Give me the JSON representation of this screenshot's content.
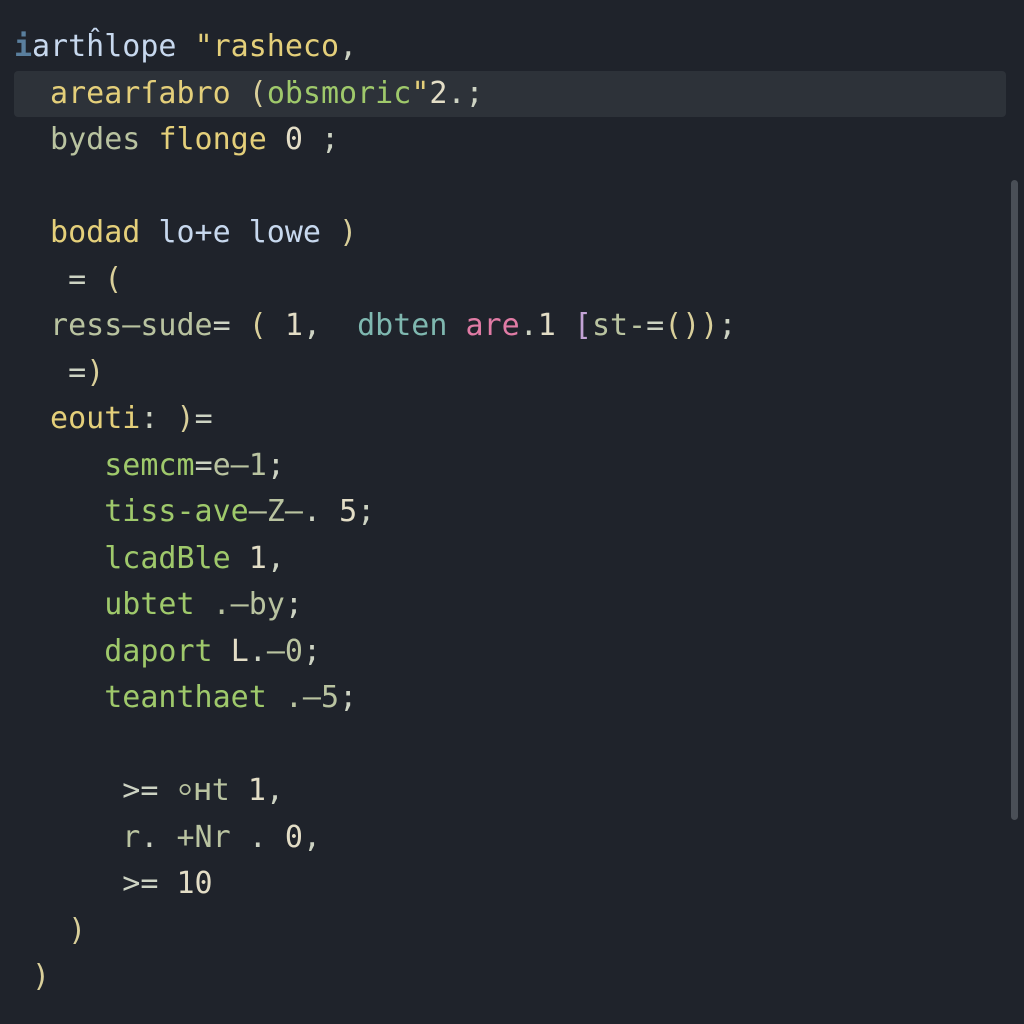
{
  "editor": {
    "gutter_mark": "i",
    "lines": [
      {
        "hl": false,
        "tokens": [
          {
            "t": "artĥlope ",
            "c": "kw"
          },
          {
            "t": "\"",
            "c": "str"
          },
          {
            "t": "rasheco",
            "c": "str"
          },
          {
            "t": ",",
            "c": "punc"
          }
        ]
      },
      {
        "hl": true,
        "tokens": [
          {
            "t": " arearſabro ",
            "c": "fn"
          },
          {
            "t": "(",
            "c": "par"
          },
          {
            "t": "oḃsmoric",
            "c": "id2"
          },
          {
            "t": "\"",
            "c": "str"
          },
          {
            "t": "2",
            "c": "num"
          },
          {
            "t": ".",
            "c": "punc"
          },
          {
            "t": ";",
            "c": "punc"
          }
        ]
      },
      {
        "hl": false,
        "tokens": [
          {
            "t": " bydes ",
            "c": "pale"
          },
          {
            "t": "flonge ",
            "c": "fn"
          },
          {
            "t": "0",
            "c": "num"
          },
          {
            "t": " ;",
            "c": "punc"
          }
        ]
      },
      {
        "hl": false,
        "tokens": [
          {
            "t": "",
            "c": "punc"
          }
        ]
      },
      {
        "hl": false,
        "tokens": [
          {
            "t": " bodad ",
            "c": "fn"
          },
          {
            "t": "lo+e ",
            "c": "kw"
          },
          {
            "t": "lowe ",
            "c": "kw"
          },
          {
            "t": ")",
            "c": "par"
          }
        ]
      },
      {
        "hl": false,
        "tokens": [
          {
            "t": "  = ",
            "c": "op"
          },
          {
            "t": "(",
            "c": "par"
          }
        ]
      },
      {
        "hl": false,
        "tokens": [
          {
            "t": " ress–sude",
            "c": "pale"
          },
          {
            "t": "= ",
            "c": "op"
          },
          {
            "t": "( ",
            "c": "par"
          },
          {
            "t": "1",
            "c": "num"
          },
          {
            "t": ", ",
            "c": "punc"
          },
          {
            "t": " dbten ",
            "c": "teal"
          },
          {
            "t": "are",
            "c": "attr"
          },
          {
            "t": ".",
            "c": "punc"
          },
          {
            "t": "1 ",
            "c": "num"
          },
          {
            "t": "[",
            "c": "br"
          },
          {
            "t": "st-",
            "c": "pale"
          },
          {
            "t": "=",
            "c": "op"
          },
          {
            "t": "(",
            "c": "par"
          },
          {
            "t": ")",
            "c": "par"
          },
          {
            "t": ")",
            "c": "par"
          },
          {
            "t": ";",
            "c": "punc"
          }
        ]
      },
      {
        "hl": false,
        "tokens": [
          {
            "t": "  =",
            "c": "op"
          },
          {
            "t": ")",
            "c": "par"
          }
        ]
      },
      {
        "hl": false,
        "tokens": [
          {
            "t": " eouti",
            "c": "fn"
          },
          {
            "t": ": ",
            "c": "punc"
          },
          {
            "t": ")",
            "c": "par"
          },
          {
            "t": "=",
            "c": "op"
          }
        ]
      },
      {
        "hl": false,
        "tokens": [
          {
            "t": "    semcm",
            "c": "id"
          },
          {
            "t": "=",
            "c": "op"
          },
          {
            "t": "e–1",
            "c": "pale"
          },
          {
            "t": ";",
            "c": "punc"
          }
        ]
      },
      {
        "hl": false,
        "tokens": [
          {
            "t": "    tiss-ave",
            "c": "id"
          },
          {
            "t": "–Z–",
            "c": "pale"
          },
          {
            "t": ". ",
            "c": "punc"
          },
          {
            "t": "5",
            "c": "num"
          },
          {
            "t": ";",
            "c": "punc"
          }
        ]
      },
      {
        "hl": false,
        "tokens": [
          {
            "t": "    lcadBle ",
            "c": "id"
          },
          {
            "t": "1",
            "c": "num"
          },
          {
            "t": ",",
            "c": "punc"
          }
        ]
      },
      {
        "hl": false,
        "tokens": [
          {
            "t": "    ubtet ",
            "c": "id"
          },
          {
            "t": ".–by",
            "c": "pale"
          },
          {
            "t": ";",
            "c": "punc"
          }
        ]
      },
      {
        "hl": false,
        "tokens": [
          {
            "t": "    daport ",
            "c": "id"
          },
          {
            "t": "L",
            "c": "num"
          },
          {
            "t": ".",
            "c": "punc"
          },
          {
            "t": "–0",
            "c": "pale"
          },
          {
            "t": ";",
            "c": "punc"
          }
        ]
      },
      {
        "hl": false,
        "tokens": [
          {
            "t": "    teanthaet ",
            "c": "id"
          },
          {
            "t": ".–5",
            "c": "pale"
          },
          {
            "t": ";",
            "c": "punc"
          }
        ]
      },
      {
        "hl": false,
        "tokens": [
          {
            "t": "",
            "c": "punc"
          }
        ]
      },
      {
        "hl": false,
        "tokens": [
          {
            "t": "     >= ",
            "c": "op"
          },
          {
            "t": "⸰ʜt ",
            "c": "pale"
          },
          {
            "t": "1",
            "c": "num"
          },
          {
            "t": ",",
            "c": "punc"
          }
        ]
      },
      {
        "hl": false,
        "tokens": [
          {
            "t": "     r",
            "c": "pale"
          },
          {
            "t": ".",
            "c": "punc"
          },
          {
            "t": " +Nr ",
            "c": "pale"
          },
          {
            "t": ". ",
            "c": "punc"
          },
          {
            "t": "0",
            "c": "num"
          },
          {
            "t": ",",
            "c": "punc"
          }
        ]
      },
      {
        "hl": false,
        "tokens": [
          {
            "t": "     >= ",
            "c": "op"
          },
          {
            "t": "10",
            "c": "num"
          }
        ]
      },
      {
        "hl": false,
        "tokens": [
          {
            "t": "  )",
            "c": "par"
          }
        ]
      },
      {
        "hl": false,
        "tokens": [
          {
            "t": ")",
            "c": "par"
          }
        ]
      }
    ]
  }
}
